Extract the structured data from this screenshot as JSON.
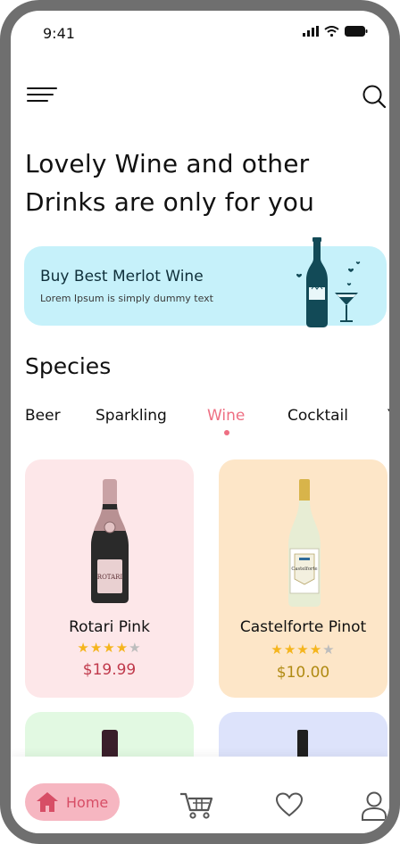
{
  "status_bar": {
    "time": "9:41"
  },
  "headline": {
    "line1": "Lovely Wine and other",
    "line2": "Drinks are only for you"
  },
  "banner": {
    "title": "Buy Best Merlot Wine",
    "subtitle": "Lorem Ipsum is simply dummy text"
  },
  "species": {
    "title": "Species",
    "tabs": [
      "Beer",
      "Sparkling",
      "Wine",
      "Cocktail",
      "Y"
    ],
    "active_tab": "Wine"
  },
  "products": [
    {
      "name": "Rotari Pink",
      "rating": 4,
      "max_rating": 5,
      "price": "$19.99",
      "bottle_label": "ROTARI"
    },
    {
      "name": "Castelforte Pinot",
      "rating": 4,
      "max_rating": 5,
      "price": "$10.00",
      "bottle_label": "Castelforte"
    }
  ],
  "bottom_nav": {
    "home_label": "Home"
  },
  "colors": {
    "accent_pink": "#ee6f83",
    "banner_bg": "#c6f1fa",
    "card_pink": "#fde7e9",
    "card_peach": "#fde6c8",
    "card_green": "#e2f9e2",
    "card_lavender": "#dde3fb",
    "price_rose": "#c0394b",
    "price_gold": "#b08a12"
  }
}
